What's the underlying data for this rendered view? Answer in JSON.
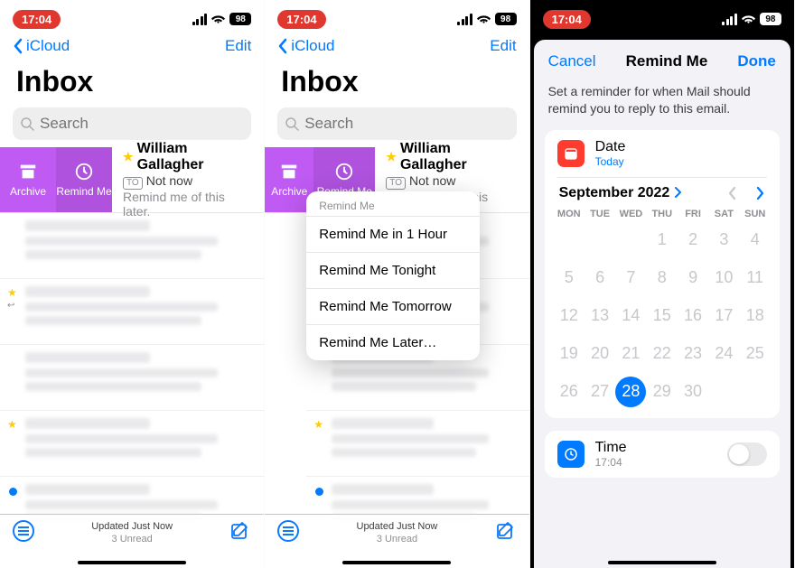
{
  "status": {
    "time": "17:04",
    "battery": "98"
  },
  "nav": {
    "back": "iCloud",
    "edit": "Edit"
  },
  "inbox": {
    "title": "Inbox",
    "search_placeholder": "Search",
    "actions": {
      "archive": "Archive",
      "remind": "Remind Me"
    },
    "message": {
      "sender": "William Gallagher",
      "subject": "Not now",
      "preview": "Remind me of this later.",
      "to_tag": "TO"
    },
    "footer": {
      "updated": "Updated Just Now",
      "unread": "3 Unread"
    }
  },
  "popover": {
    "header": "Remind Me",
    "items": [
      "Remind Me in 1 Hour",
      "Remind Me Tonight",
      "Remind Me Tomorrow",
      "Remind Me Later…"
    ]
  },
  "sheet": {
    "cancel": "Cancel",
    "title": "Remind Me",
    "done": "Done",
    "desc": "Set a reminder for when Mail should remind you to reply to this email.",
    "date_label": "Date",
    "date_sub": "Today",
    "time_label": "Time",
    "time_sub": "17:04",
    "month": "September 2022",
    "weekdays": [
      "MON",
      "TUE",
      "WED",
      "THU",
      "FRI",
      "SAT",
      "SUN"
    ],
    "grid": [
      "",
      "",
      "",
      "1",
      "2",
      "3",
      "4",
      "5",
      "6",
      "7",
      "8",
      "9",
      "10",
      "11",
      "12",
      "13",
      "14",
      "15",
      "16",
      "17",
      "18",
      "19",
      "20",
      "21",
      "22",
      "23",
      "24",
      "25",
      "26",
      "27",
      "28",
      "29",
      "30",
      "",
      ""
    ],
    "selected": "28"
  }
}
